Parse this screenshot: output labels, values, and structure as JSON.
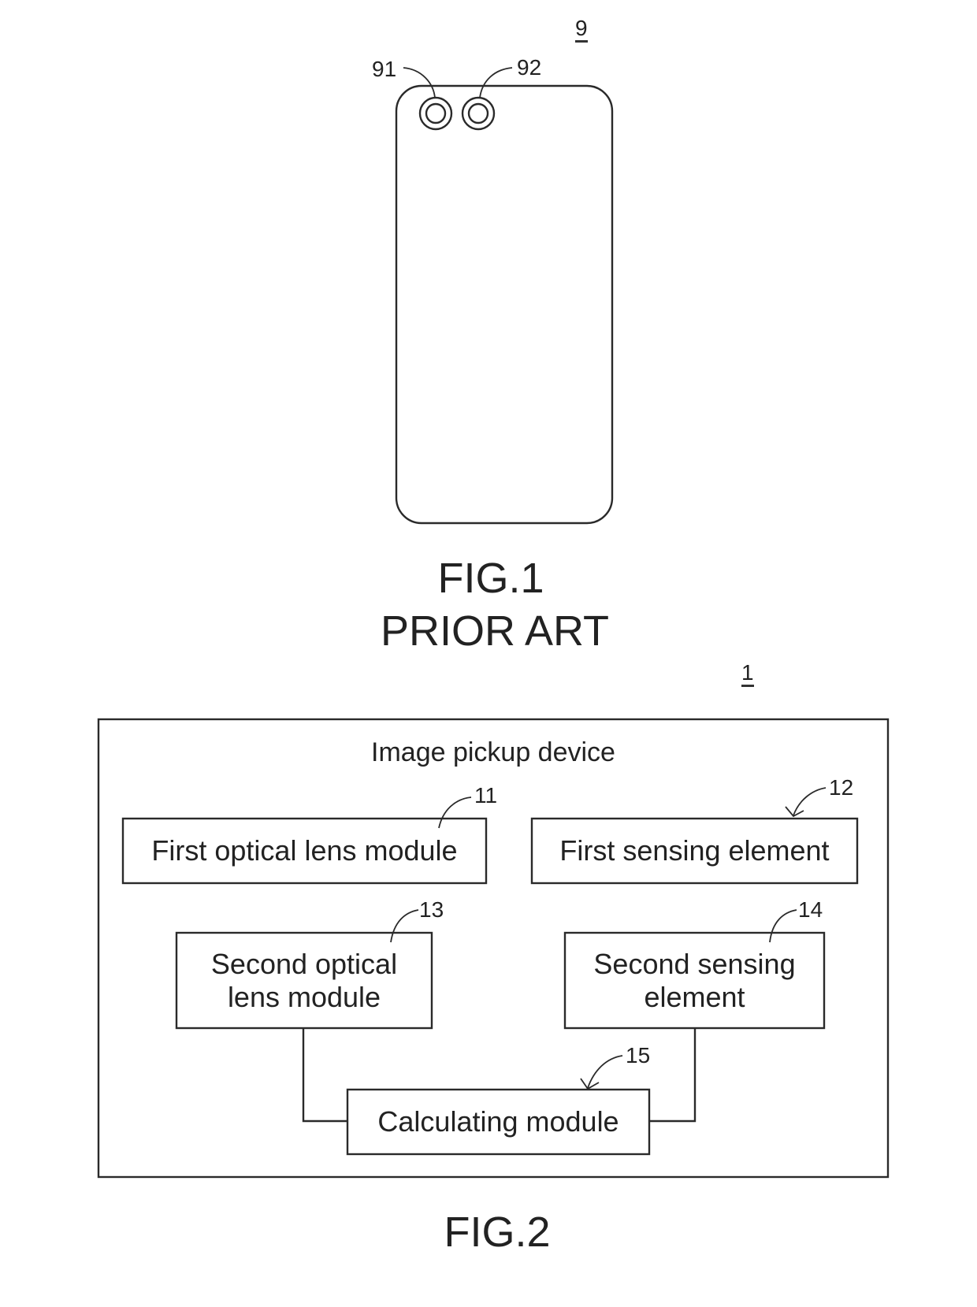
{
  "fig1": {
    "reference_numeral": "9",
    "lens_labels": [
      "91",
      "92"
    ],
    "caption": "FIG.1",
    "subcaption": "PRIOR ART"
  },
  "fig2": {
    "reference_numeral": "1",
    "container_title": "Image pickup device",
    "blocks": [
      {
        "ref": "11",
        "label": "First optical lens module"
      },
      {
        "ref": "12",
        "label": "First sensing element"
      },
      {
        "ref": "13",
        "label_line1": "Second optical",
        "label_line2": "lens module"
      },
      {
        "ref": "14",
        "label_line1": "Second sensing",
        "label_line2": "element"
      },
      {
        "ref": "15",
        "label": "Calculating module"
      }
    ],
    "caption": "FIG.2"
  }
}
